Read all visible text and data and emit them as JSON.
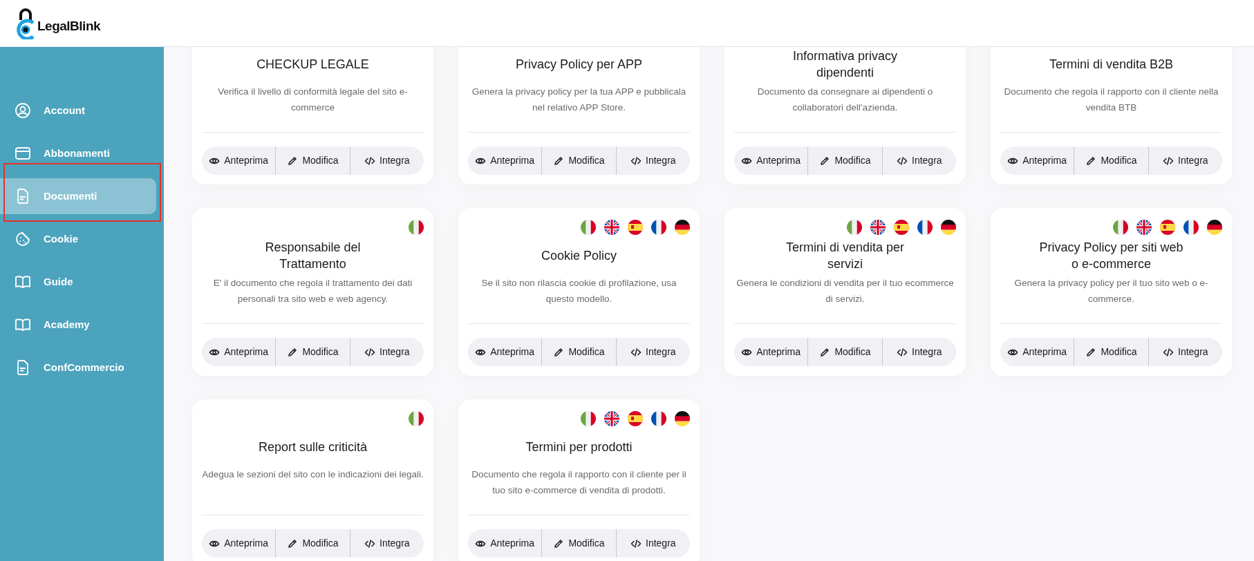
{
  "header": {
    "logo_text": "LegalBlink"
  },
  "sidebar": {
    "items": [
      {
        "label": "Account",
        "kind": "user",
        "selected": false,
        "highlighted": false
      },
      {
        "label": "Abbonamenti",
        "kind": "card",
        "selected": false,
        "highlighted": false
      },
      {
        "label": "Documenti",
        "kind": "doc",
        "selected": true,
        "highlighted": true
      },
      {
        "label": "Cookie",
        "kind": "cookie",
        "selected": false,
        "highlighted": false
      },
      {
        "label": "Guide",
        "kind": "book",
        "selected": false,
        "highlighted": false
      },
      {
        "label": "Academy",
        "kind": "book",
        "selected": false,
        "highlighted": false
      },
      {
        "label": "ConfCommercio",
        "kind": "doc",
        "selected": false,
        "highlighted": false
      }
    ]
  },
  "cards": [
    {
      "title": "CHECKUP LEGALE",
      "description": "Verifica il livello di conformità legale del sito e-commerce",
      "actions": [
        {
          "kind": "preview",
          "label": "Anteprima"
        },
        {
          "kind": "edit",
          "label": "Modifica"
        },
        {
          "kind": "embed",
          "label": "Integra"
        }
      ]
    },
    {
      "title": "Privacy Policy per APP",
      "description": "Genera la privacy policy per la tua APP e pubblicala nel relativo APP Store.",
      "actions": [
        {
          "kind": "preview",
          "label": "Anteprima"
        },
        {
          "kind": "edit",
          "label": "Modifica"
        },
        {
          "kind": "embed",
          "label": "Integra"
        }
      ]
    },
    {
      "title": "Informativa privacy\ndipendenti",
      "description": "Documento da consegnare ai dipendenti o collaboratori dell'azienda.",
      "actions": [
        {
          "kind": "preview",
          "label": "Anteprima"
        },
        {
          "kind": "edit",
          "label": "Modifica"
        },
        {
          "kind": "embed",
          "label": "Integra"
        }
      ]
    },
    {
      "title": "Termini di vendita B2B",
      "description": "Documento che regola il rapporto con il cliente nella vendita BTB",
      "actions": [
        {
          "kind": "preview",
          "label": "Anteprima"
        },
        {
          "kind": "edit",
          "label": "Modifica"
        },
        {
          "kind": "embed",
          "label": "Integra"
        }
      ]
    },
    {
      "flags": [
        {
          "kind": "it"
        }
      ],
      "title": "Responsabile del\nTrattamento",
      "description": "E' il documento che regola il trattamento dei dati personali tra sito web e web agency.",
      "actions": [
        {
          "kind": "preview",
          "label": "Anteprima"
        },
        {
          "kind": "edit",
          "label": "Modifica"
        },
        {
          "kind": "embed",
          "label": "Integra"
        }
      ]
    },
    {
      "flags": [
        {
          "kind": "it"
        },
        {
          "kind": "gb"
        },
        {
          "kind": "es"
        },
        {
          "kind": "fr"
        },
        {
          "kind": "de"
        }
      ],
      "title": "Cookie Policy",
      "description": "Se il sito non rilascia cookie di profilazione, usa questo modello.",
      "actions": [
        {
          "kind": "preview",
          "label": "Anteprima"
        },
        {
          "kind": "edit",
          "label": "Modifica"
        },
        {
          "kind": "embed",
          "label": "Integra"
        }
      ]
    },
    {
      "flags": [
        {
          "kind": "it"
        },
        {
          "kind": "gb"
        },
        {
          "kind": "es"
        },
        {
          "kind": "fr"
        },
        {
          "kind": "de"
        }
      ],
      "title": "Termini di vendita per\nservizi",
      "description": "Genera le condizioni di vendita per il tuo ecommerce di servizi.",
      "actions": [
        {
          "kind": "preview",
          "label": "Anteprima"
        },
        {
          "kind": "edit",
          "label": "Modifica"
        },
        {
          "kind": "embed",
          "label": "Integra"
        }
      ]
    },
    {
      "flags": [
        {
          "kind": "it"
        },
        {
          "kind": "gb"
        },
        {
          "kind": "es"
        },
        {
          "kind": "fr"
        },
        {
          "kind": "de"
        }
      ],
      "title": "Privacy Policy per siti web\no e-commerce",
      "description": "Genera la privacy policy per il tuo sito web o e-commerce.",
      "actions": [
        {
          "kind": "preview",
          "label": "Anteprima"
        },
        {
          "kind": "edit",
          "label": "Modifica"
        },
        {
          "kind": "embed",
          "label": "Integra"
        }
      ]
    },
    {
      "flags": [
        {
          "kind": "it"
        }
      ],
      "title": "Report sulle criticità",
      "description": "Adegua le sezioni del sito con le indicazioni dei legali.",
      "actions": [
        {
          "kind": "preview",
          "label": "Anteprima"
        },
        {
          "kind": "edit",
          "label": "Modifica"
        },
        {
          "kind": "embed",
          "label": "Integra"
        }
      ]
    },
    {
      "flags": [
        {
          "kind": "it"
        },
        {
          "kind": "gb"
        },
        {
          "kind": "es"
        },
        {
          "kind": "fr"
        },
        {
          "kind": "de"
        }
      ],
      "title": "Termini per prodotti",
      "description": "Documento che regola il rapporto con il cliente per il tuo sito e-commerce di vendita di prodotti.",
      "actions": [
        {
          "kind": "preview",
          "label": "Anteprima"
        },
        {
          "kind": "edit",
          "label": "Modifica"
        },
        {
          "kind": "embed",
          "label": "Integra"
        }
      ]
    }
  ]
}
